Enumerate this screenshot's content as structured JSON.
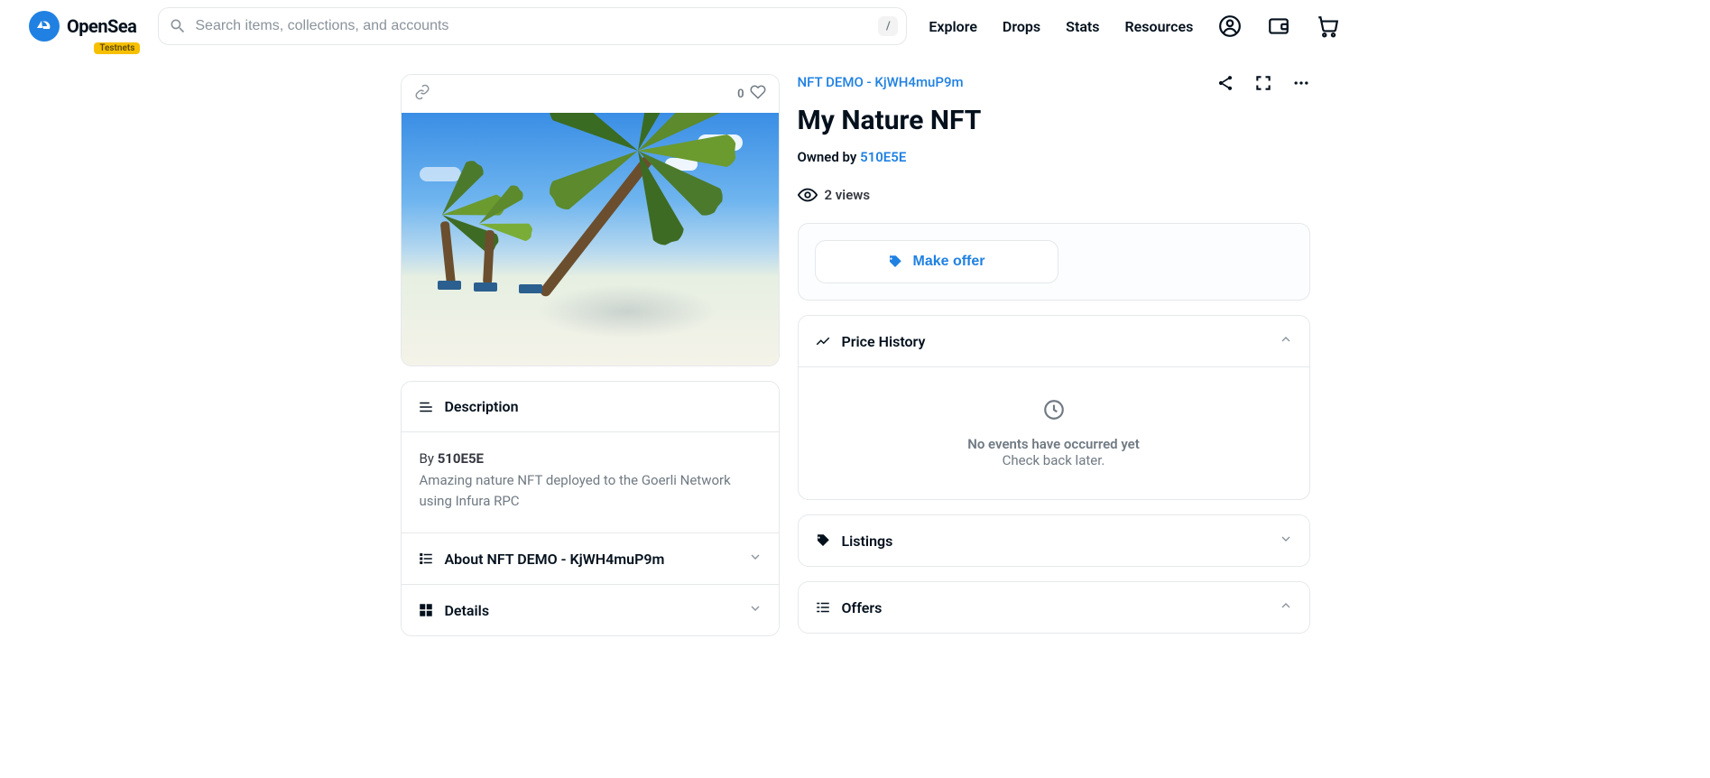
{
  "header": {
    "brand": "OpenSea",
    "badge": "Testnets",
    "search_placeholder": "Search items, collections, and accounts",
    "slash_key": "/",
    "nav": {
      "explore": "Explore",
      "drops": "Drops",
      "stats": "Stats",
      "resources": "Resources"
    }
  },
  "image_card": {
    "like_count": "0"
  },
  "left": {
    "description_title": "Description",
    "creator_prefix": "By",
    "creator_name": "510E5E",
    "description_text": "Amazing nature NFT deployed to the Goerli Network using Infura RPC",
    "about_title": "About NFT DEMO - KjWH4muP9m",
    "details_title": "Details"
  },
  "right": {
    "collection_name": "NFT DEMO - KjWH4muP9m",
    "nft_title": "My Nature NFT",
    "owned_by_prefix": "Owned by",
    "owner": "510E5E",
    "views": "2 views",
    "make_offer": "Make offer",
    "price_history_title": "Price History",
    "no_events_title": "No events have occurred yet",
    "no_events_sub": "Check back later.",
    "listings_title": "Listings",
    "offers_title": "Offers"
  }
}
